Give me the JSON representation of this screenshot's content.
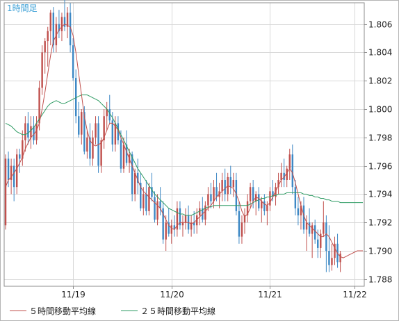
{
  "timeframe_label": "1時間足",
  "legend": [
    {
      "label": "５時間移動平均線",
      "color": "#c0504d"
    },
    {
      "label": "２５時間移動平均線",
      "color": "#2e9b63"
    }
  ],
  "colors": {
    "up": "#c0504d",
    "down": "#3d88c5",
    "ma5": "#c0504d",
    "ma25": "#2e9b63",
    "grid": "#d8d8d8",
    "axis": "#8c8c8c"
  },
  "chart_data": {
    "type": "candlestick",
    "ylim": [
      1.7875,
      1.8075
    ],
    "y_ticks": [
      "1.788",
      "1.790",
      "1.792",
      "1.794",
      "1.796",
      "1.798",
      "1.800",
      "1.802",
      "1.804",
      "1.806"
    ],
    "y_tick_values": [
      1.788,
      1.79,
      1.792,
      1.794,
      1.796,
      1.798,
      1.8,
      1.802,
      1.804,
      1.806
    ],
    "x_ticks": [
      {
        "label": "11/19",
        "index": 24
      },
      {
        "label": "11/20",
        "index": 59
      },
      {
        "label": "11/21",
        "index": 94
      },
      {
        "label": "11/22",
        "index": 124
      }
    ],
    "n_candles": 128,
    "candles": [
      [
        1.7918,
        1.7968,
        1.7915,
        1.7965
      ],
      [
        1.7965,
        1.797,
        1.7945,
        1.795
      ],
      [
        1.795,
        1.7965,
        1.794,
        1.796
      ],
      [
        1.796,
        1.7965,
        1.7935,
        1.7945
      ],
      [
        1.7945,
        1.7972,
        1.794,
        1.7968
      ],
      [
        1.7968,
        1.7972,
        1.7955,
        1.7965
      ],
      [
        1.7965,
        1.7985,
        1.796,
        1.7978
      ],
      [
        1.7978,
        1.7995,
        1.797,
        1.799
      ],
      [
        1.799,
        1.7998,
        1.7975,
        1.798
      ],
      [
        1.798,
        1.7995,
        1.7972,
        1.7988
      ],
      [
        1.7988,
        1.7995,
        1.7975,
        1.7978
      ],
      [
        1.7978,
        1.7995,
        1.7975,
        1.799
      ],
      [
        1.799,
        1.802,
        1.7985,
        1.8015
      ],
      [
        1.8015,
        1.8045,
        1.801,
        1.804
      ],
      [
        1.804,
        1.805,
        1.8025,
        1.8048
      ],
      [
        1.8048,
        1.8058,
        1.803,
        1.8055
      ],
      [
        1.8055,
        1.807,
        1.8045,
        1.8068
      ],
      [
        1.8068,
        1.8072,
        1.804,
        1.8045
      ],
      [
        1.8045,
        1.8065,
        1.804,
        1.806
      ],
      [
        1.806,
        1.807,
        1.805,
        1.8055
      ],
      [
        1.8055,
        1.8068,
        1.8048,
        1.8065
      ],
      [
        1.8065,
        1.8078,
        1.8055,
        1.8058
      ],
      [
        1.8058,
        1.8072,
        1.805,
        1.8068
      ],
      [
        1.8068,
        1.8075,
        1.804,
        1.8045
      ],
      [
        1.8045,
        1.805,
        1.802,
        1.8022
      ],
      [
        1.8022,
        1.8028,
        1.799,
        1.7995
      ],
      [
        1.7995,
        1.8005,
        1.798,
        1.7982
      ],
      [
        1.7982,
        1.8,
        1.7975,
        1.7998
      ],
      [
        1.7998,
        1.8002,
        1.7968,
        1.797
      ],
      [
        1.797,
        1.7985,
        1.7965,
        1.798
      ],
      [
        1.798,
        1.799,
        1.796,
        1.7965
      ],
      [
        1.7965,
        1.7985,
        1.796,
        1.798
      ],
      [
        1.798,
        1.7995,
        1.7975,
        1.799
      ],
      [
        1.799,
        1.7995,
        1.7955,
        1.796
      ],
      [
        1.796,
        1.798,
        1.7955,
        1.7978
      ],
      [
        1.7978,
        1.8,
        1.7972,
        1.7995
      ],
      [
        1.7995,
        1.8005,
        1.7985,
        1.8
      ],
      [
        1.8,
        1.801,
        1.799,
        1.7992
      ],
      [
        1.7992,
        1.7998,
        1.797,
        1.7975
      ],
      [
        1.7975,
        1.7995,
        1.797,
        1.799
      ],
      [
        1.799,
        1.7995,
        1.7975,
        1.7978
      ],
      [
        1.7978,
        1.7985,
        1.7955,
        1.7958
      ],
      [
        1.7958,
        1.798,
        1.7955,
        1.7975
      ],
      [
        1.7975,
        1.7985,
        1.796,
        1.7962
      ],
      [
        1.7962,
        1.7972,
        1.7955,
        1.7968
      ],
      [
        1.7968,
        1.797,
        1.7935,
        1.794
      ],
      [
        1.794,
        1.7958,
        1.7935,
        1.7955
      ],
      [
        1.7955,
        1.7965,
        1.794,
        1.7948
      ],
      [
        1.7948,
        1.7955,
        1.7928,
        1.793
      ],
      [
        1.793,
        1.7945,
        1.7925,
        1.794
      ],
      [
        1.794,
        1.795,
        1.7925,
        1.7928
      ],
      [
        1.7928,
        1.7948,
        1.7925,
        1.7945
      ],
      [
        1.7945,
        1.7955,
        1.7935,
        1.7938
      ],
      [
        1.7938,
        1.7942,
        1.792,
        1.7922
      ],
      [
        1.7922,
        1.794,
        1.7918,
        1.7935
      ],
      [
        1.7935,
        1.7945,
        1.7925,
        1.793
      ],
      [
        1.793,
        1.7935,
        1.7905,
        1.7908
      ],
      [
        1.7908,
        1.7925,
        1.79,
        1.792
      ],
      [
        1.792,
        1.793,
        1.791,
        1.7912
      ],
      [
        1.7912,
        1.7922,
        1.7905,
        1.7918
      ],
      [
        1.7918,
        1.7925,
        1.791,
        1.7915
      ],
      [
        1.7915,
        1.7935,
        1.791,
        1.793
      ],
      [
        1.793,
        1.7935,
        1.7915,
        1.7918
      ],
      [
        1.7918,
        1.7925,
        1.791,
        1.792
      ],
      [
        1.792,
        1.793,
        1.7915,
        1.7925
      ],
      [
        1.7925,
        1.7932,
        1.7912,
        1.7915
      ],
      [
        1.7915,
        1.7925,
        1.791,
        1.792
      ],
      [
        1.792,
        1.7928,
        1.7912,
        1.7918
      ],
      [
        1.7918,
        1.793,
        1.7912,
        1.7925
      ],
      [
        1.7925,
        1.7935,
        1.7918,
        1.793
      ],
      [
        1.793,
        1.7938,
        1.792,
        1.7922
      ],
      [
        1.7922,
        1.7935,
        1.7918,
        1.7932
      ],
      [
        1.7932,
        1.7945,
        1.7928,
        1.794
      ],
      [
        1.794,
        1.7948,
        1.793,
        1.7935
      ],
      [
        1.7935,
        1.795,
        1.793,
        1.7945
      ],
      [
        1.7945,
        1.7955,
        1.7935,
        1.7938
      ],
      [
        1.7938,
        1.7948,
        1.793,
        1.7942
      ],
      [
        1.7942,
        1.7955,
        1.7935,
        1.795
      ],
      [
        1.795,
        1.7958,
        1.7935,
        1.794
      ],
      [
        1.794,
        1.7955,
        1.7935,
        1.7952
      ],
      [
        1.7952,
        1.796,
        1.794,
        1.7945
      ],
      [
        1.7945,
        1.7955,
        1.7938,
        1.795
      ],
      [
        1.795,
        1.7955,
        1.7925,
        1.7928
      ],
      [
        1.7928,
        1.7935,
        1.7905,
        1.791
      ],
      [
        1.791,
        1.7925,
        1.7905,
        1.792
      ],
      [
        1.792,
        1.793,
        1.7912,
        1.7925
      ],
      [
        1.7925,
        1.794,
        1.792,
        1.7935
      ],
      [
        1.7935,
        1.7948,
        1.793,
        1.7945
      ],
      [
        1.7945,
        1.795,
        1.793,
        1.7935
      ],
      [
        1.7935,
        1.7942,
        1.7925,
        1.794
      ],
      [
        1.794,
        1.7945,
        1.7928,
        1.793
      ],
      [
        1.793,
        1.7938,
        1.792,
        1.7935
      ],
      [
        1.7935,
        1.794,
        1.7925,
        1.7928
      ],
      [
        1.7928,
        1.7935,
        1.7918,
        1.7932
      ],
      [
        1.7932,
        1.7945,
        1.7928,
        1.7942
      ],
      [
        1.7942,
        1.795,
        1.7935,
        1.7938
      ],
      [
        1.7938,
        1.7948,
        1.7932,
        1.7945
      ],
      [
        1.7945,
        1.7955,
        1.794,
        1.795
      ],
      [
        1.795,
        1.7962,
        1.7945,
        1.7955
      ],
      [
        1.7955,
        1.7965,
        1.7945,
        1.795
      ],
      [
        1.795,
        1.796,
        1.7945,
        1.7958
      ],
      [
        1.7958,
        1.7972,
        1.795,
        1.7968
      ],
      [
        1.7968,
        1.7975,
        1.794,
        1.7945
      ],
      [
        1.7945,
        1.795,
        1.7925,
        1.793
      ],
      [
        1.793,
        1.7938,
        1.7918,
        1.7925
      ],
      [
        1.7925,
        1.7935,
        1.7915,
        1.7932
      ],
      [
        1.7932,
        1.7938,
        1.7912,
        1.7915
      ],
      [
        1.7915,
        1.7925,
        1.79,
        1.792
      ],
      [
        1.792,
        1.793,
        1.791,
        1.7912
      ],
      [
        1.7912,
        1.792,
        1.7895,
        1.7918
      ],
      [
        1.7918,
        1.7922,
        1.7905,
        1.7908
      ],
      [
        1.7908,
        1.7915,
        1.7895,
        1.7902
      ],
      [
        1.7902,
        1.7915,
        1.7895,
        1.7912
      ],
      [
        1.7912,
        1.7935,
        1.791,
        1.792
      ],
      [
        1.792,
        1.7925,
        1.7885,
        1.79
      ],
      [
        1.79,
        1.7918,
        1.7885,
        1.789
      ],
      [
        1.789,
        1.7905,
        1.7886,
        1.7895
      ],
      [
        1.7895,
        1.791,
        1.789,
        1.7905
      ],
      [
        1.7905,
        1.7912,
        1.7888,
        1.7892
      ],
      [
        1.7892,
        1.79,
        1.7885,
        1.7898
      ]
    ],
    "ma5": [
      1.7945,
      1.795,
      1.7952,
      1.7955,
      1.7958,
      1.7962,
      1.7966,
      1.7972,
      1.7976,
      1.798,
      1.7982,
      1.7985,
      1.799,
      1.8,
      1.8012,
      1.8025,
      1.8038,
      1.8048,
      1.8052,
      1.8056,
      1.8058,
      1.806,
      1.8059,
      1.8058,
      1.8052,
      1.804,
      1.8025,
      1.801,
      1.7995,
      1.7985,
      1.7978,
      1.7975,
      1.7974,
      1.7975,
      1.7976,
      1.798,
      1.7985,
      1.799,
      1.799,
      1.7988,
      1.7985,
      1.798,
      1.7975,
      1.797,
      1.7965,
      1.796,
      1.7955,
      1.795,
      1.7945,
      1.7942,
      1.794,
      1.7938,
      1.7936,
      1.7934,
      1.7932,
      1.793,
      1.7926,
      1.7922,
      1.7918,
      1.7916,
      1.7915,
      1.7918,
      1.792,
      1.792,
      1.792,
      1.792,
      1.7919,
      1.792,
      1.7922,
      1.7924,
      1.7926,
      1.7928,
      1.793,
      1.7932,
      1.7935,
      1.7938,
      1.794,
      1.7942,
      1.7944,
      1.7946,
      1.7945,
      1.7944,
      1.794,
      1.7935,
      1.7928,
      1.7924,
      1.7926,
      1.793,
      1.7935,
      1.7938,
      1.7937,
      1.7935,
      1.7933,
      1.7932,
      1.7934,
      1.7938,
      1.7942,
      1.7946,
      1.795,
      1.7952,
      1.7955,
      1.7958,
      1.7955,
      1.7948,
      1.794,
      1.7932,
      1.7925,
      1.792,
      1.7918,
      1.7916,
      1.7914,
      1.7912,
      1.791,
      1.791,
      1.7912,
      1.791,
      1.7906,
      1.7902,
      1.7898,
      1.7896,
      1.7895,
      1.7896,
      1.7897,
      1.7898,
      1.7899,
      1.79,
      1.79,
      1.79
    ],
    "ma25": [
      1.799,
      1.7989,
      1.7988,
      1.7986,
      1.7984,
      1.7983,
      1.7982,
      1.7982,
      1.7983,
      1.7985,
      1.7987,
      1.799,
      1.7993,
      1.7996,
      1.7999,
      1.8002,
      1.8004,
      1.8005,
      1.8006,
      1.8005,
      1.8004,
      1.8004,
      1.8005,
      1.8006,
      1.8007,
      1.8008,
      1.8009,
      1.801,
      1.801,
      1.801,
      1.8009,
      1.8008,
      1.8007,
      1.8006,
      1.8004,
      1.8002,
      1.8,
      1.7997,
      1.7994,
      1.799,
      1.7986,
      1.7982,
      1.7978,
      1.7974,
      1.797,
      1.7966,
      1.7962,
      1.7958,
      1.7955,
      1.7952,
      1.7949,
      1.7946,
      1.7943,
      1.794,
      1.7938,
      1.7936,
      1.7934,
      1.7932,
      1.793,
      1.7929,
      1.7928,
      1.7927,
      1.7926,
      1.7926,
      1.7925,
      1.7925,
      1.7925,
      1.7926,
      1.7927,
      1.7928,
      1.7929,
      1.793,
      1.7931,
      1.7931,
      1.7932,
      1.7932,
      1.7932,
      1.7932,
      1.7932,
      1.7932,
      1.7932,
      1.7932,
      1.7932,
      1.7932,
      1.7932,
      1.7932,
      1.7932,
      1.7933,
      1.7934,
      1.7935,
      1.7936,
      1.7937,
      1.7937,
      1.7938,
      1.7938,
      1.7939,
      1.7939,
      1.794,
      1.794,
      1.794,
      1.7941,
      1.7941,
      1.7941,
      1.7941,
      1.7941,
      1.7941,
      1.794,
      1.794,
      1.7939,
      1.7939,
      1.7938,
      1.7938,
      1.7937,
      1.7937,
      1.7936,
      1.7936,
      1.7935,
      1.7935,
      1.7935,
      1.7934,
      1.7934,
      1.7934,
      1.7934,
      1.7934,
      1.7934,
      1.7934,
      1.7934,
      1.7934
    ]
  }
}
